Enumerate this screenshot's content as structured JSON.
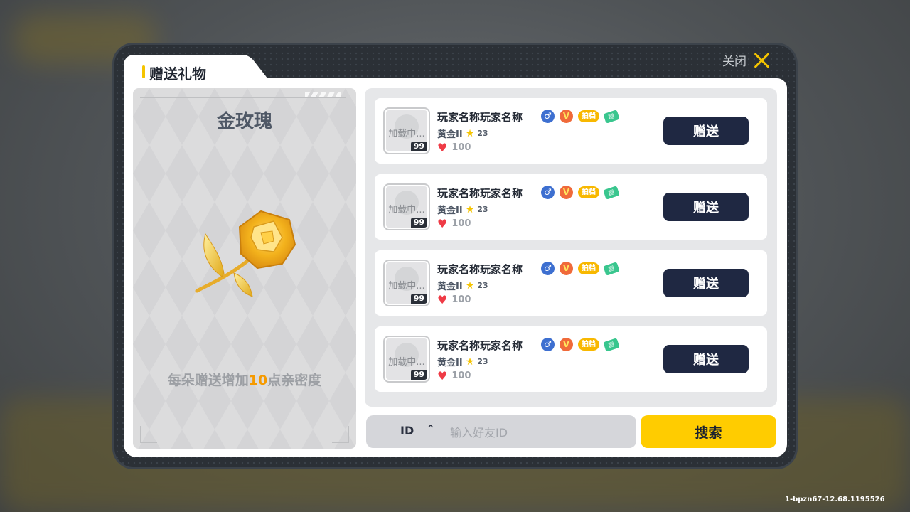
{
  "dialog": {
    "title": "赠送礼物",
    "close_label": "关闭"
  },
  "gift": {
    "name": "金玫瑰",
    "desc_prefix": "每朵赠送增加",
    "desc_value": "10",
    "desc_suffix": "点亲密度"
  },
  "players": [
    {
      "avatar_text": "加载中...",
      "level": "99",
      "name": "玩家名称玩家名称",
      "tag": "拍档",
      "rank": "黄金II",
      "stars": "23",
      "intimacy": "100",
      "send_label": "赠送"
    },
    {
      "avatar_text": "加载中...",
      "level": "99",
      "name": "玩家名称玩家名称",
      "tag": "拍档",
      "rank": "黄金II",
      "stars": "23",
      "intimacy": "100",
      "send_label": "赠送"
    },
    {
      "avatar_text": "加载中...",
      "level": "99",
      "name": "玩家名称玩家名称",
      "tag": "拍档",
      "rank": "黄金II",
      "stars": "23",
      "intimacy": "100",
      "send_label": "赠送"
    },
    {
      "avatar_text": "加载中...",
      "level": "99",
      "name": "玩家名称玩家名称",
      "tag": "拍档",
      "rank": "黄金II",
      "stars": "23",
      "intimacy": "100",
      "send_label": "赠送"
    }
  ],
  "search": {
    "type_value": "ID",
    "placeholder": "输入好友ID",
    "button_label": "搜索"
  },
  "build_info": "1-bpzn67-12.68.1195526",
  "colors": {
    "accent": "#ffcc00",
    "button_dark": "#1f2842",
    "highlight": "#f59a00"
  },
  "icons": [
    "close-icon",
    "male-icon",
    "vip-icon",
    "money-icon",
    "star-icon",
    "heart-icon",
    "caret-up-icon"
  ]
}
